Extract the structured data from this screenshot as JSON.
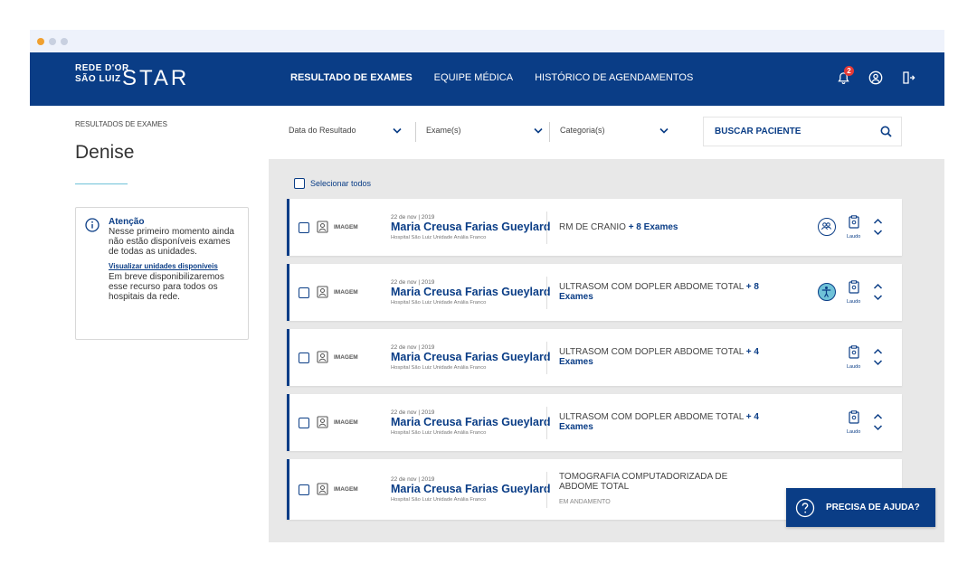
{
  "app": {
    "logo_line1": "REDE D'OR",
    "logo_line2": "SÃO LUIZ",
    "logo_product": "STAR"
  },
  "nav": {
    "links": [
      "RESULTADO DE EXAMES",
      "EQUIPE MÉDICA",
      "HISTÓRICO DE AGENDAMENTOS"
    ],
    "notification_count": "2"
  },
  "sidebar": {
    "breadcrumb": "RESULTADOS DE EXAMES",
    "patient": "Denise",
    "attention": {
      "title": "Atenção",
      "text1": "Nesse primeiro momento ainda não estão disponíveis exames de todas as unidades.",
      "link": "Visualizar unidades disponíveis",
      "text2": "Em breve disponibilizaremos esse recurso para todos os hospitais da rede."
    }
  },
  "filters": {
    "date": "Data do Resultado",
    "exam": "Exame(s)",
    "category": "Categoria(s)",
    "search_placeholder": "BUSCAR PACIENTE"
  },
  "select_all": "Selecionar todos",
  "cards": [
    {
      "type": "IMAGEM",
      "date": "22 de nov | 2019",
      "patient": "Maria Creusa Farias Gueylard",
      "hospital": "Hospital São Luiz Unidade Anália Franco",
      "exam": "RM DE CRANIO",
      "more": "+ 8 Exames",
      "status": "",
      "laudo": "Laudo"
    },
    {
      "type": "IMAGEM",
      "date": "22 de nov | 2019",
      "patient": "Maria Creusa Farias Gueylard",
      "hospital": "Hospital São Luiz Unidade Anália Franco",
      "exam": "ULTRASOM COM DOPLER ABDOME TOTAL",
      "more": "+ 8 Exames",
      "status": "",
      "laudo": "Laudo"
    },
    {
      "type": "IMAGEM",
      "date": "22 de nov | 2019",
      "patient": "Maria Creusa Farias Gueylard",
      "hospital": "Hospital São Luiz Unidade Anália Franco",
      "exam": "ULTRASOM COM DOPLER ABDOME TOTAL",
      "more": "+ 4 Exames",
      "status": "",
      "laudo": "Laudo"
    },
    {
      "type": "IMAGEM",
      "date": "22 de nov | 2019",
      "patient": "Maria Creusa Farias Gueylard",
      "hospital": "Hospital São Luiz Unidade Anália Franco",
      "exam": "ULTRASOM COM DOPLER ABDOME TOTAL",
      "more": "+ 4 Exames",
      "status": "",
      "laudo": "Laudo"
    },
    {
      "type": "IMAGEM",
      "date": "22 de nov | 2019",
      "patient": "Maria Creusa Farias Gueylard",
      "hospital": "Hospital São Luiz Unidade Anália Franco",
      "exam": "TOMOGRAFIA COMPUTADORIZADA DE ABDOME TOTAL",
      "more": "",
      "status": "EM ANDAMENTO",
      "laudo": ""
    }
  ],
  "help": "PRECISA DE AJUDA?",
  "colors": {
    "primary": "#0a3d86",
    "accent": "#6fc2d8",
    "badge": "#e53935",
    "background": "#e8e8e8"
  }
}
